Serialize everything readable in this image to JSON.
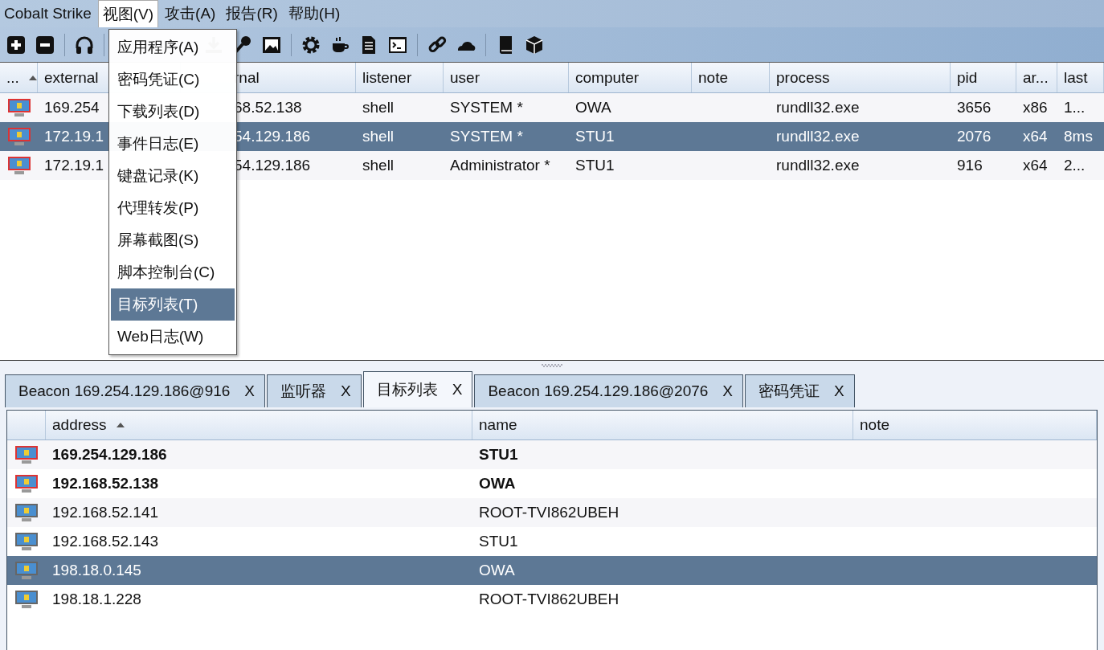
{
  "menubar": [
    {
      "label": "Cobalt Strike",
      "selected": false
    },
    {
      "label": "视图(V)",
      "selected": true
    },
    {
      "label": "攻击(A)",
      "selected": false
    },
    {
      "label": "报告(R)",
      "selected": false
    },
    {
      "label": "帮助(H)",
      "selected": false
    }
  ],
  "view_menu": [
    {
      "label": "应用程序(A)",
      "selected": false
    },
    {
      "label": "密码凭证(C)",
      "selected": false
    },
    {
      "label": "下载列表(D)",
      "selected": false
    },
    {
      "label": "事件日志(E)",
      "selected": false
    },
    {
      "label": "键盘记录(K)",
      "selected": false
    },
    {
      "label": "代理转发(P)",
      "selected": false
    },
    {
      "label": "屏幕截图(S)",
      "selected": false
    },
    {
      "label": "脚本控制台(C)",
      "selected": false
    },
    {
      "label": "目标列表(T)",
      "selected": true
    },
    {
      "label": "Web日志(W)",
      "selected": false
    }
  ],
  "sessions": {
    "icon_column_header": "...",
    "columns": [
      "external",
      "rnal",
      "listener",
      "user",
      "computer",
      "note",
      "process",
      "pid",
      "ar...",
      "last"
    ],
    "rows": [
      {
        "selected": false,
        "cells": [
          "169.254",
          "68.52.138",
          "shell",
          "SYSTEM *",
          "OWA",
          "",
          "rundll32.exe",
          "3656",
          "x86",
          "1..."
        ]
      },
      {
        "selected": true,
        "cells": [
          "172.19.1",
          "54.129.186",
          "shell",
          "SYSTEM *",
          "STU1",
          "",
          "rundll32.exe",
          "2076",
          "x64",
          "8ms"
        ]
      },
      {
        "selected": false,
        "cells": [
          "172.19.1",
          "54.129.186",
          "shell",
          "Administrator *",
          "STU1",
          "",
          "rundll32.exe",
          "916",
          "x64",
          "2..."
        ]
      }
    ]
  },
  "tabs": [
    {
      "label": "Beacon 169.254.129.186@916",
      "close": "X",
      "selected": false
    },
    {
      "label": "监听器",
      "close": "X",
      "selected": false
    },
    {
      "label": "目标列表",
      "close": "X",
      "selected": true
    },
    {
      "label": "Beacon 169.254.129.186@2076",
      "close": "X",
      "selected": false
    },
    {
      "label": "密码凭证",
      "close": "X",
      "selected": false
    }
  ],
  "targets": {
    "columns": [
      "address",
      "name",
      "note"
    ],
    "rows": [
      {
        "kind": "session",
        "selected": false,
        "address": "169.254.129.186",
        "name": "STU1"
      },
      {
        "kind": "session",
        "selected": false,
        "address": "192.168.52.138",
        "name": "OWA"
      },
      {
        "kind": "host",
        "selected": false,
        "address": "192.168.52.141",
        "name": "ROOT-TVI862UBEH"
      },
      {
        "kind": "host",
        "selected": false,
        "address": "192.168.52.143",
        "name": "STU1"
      },
      {
        "kind": "host",
        "selected": true,
        "address": "198.18.0.145",
        "name": "OWA"
      },
      {
        "kind": "host",
        "selected": false,
        "address": "198.18.1.228",
        "name": "ROOT-TVI862UBEH"
      }
    ]
  }
}
